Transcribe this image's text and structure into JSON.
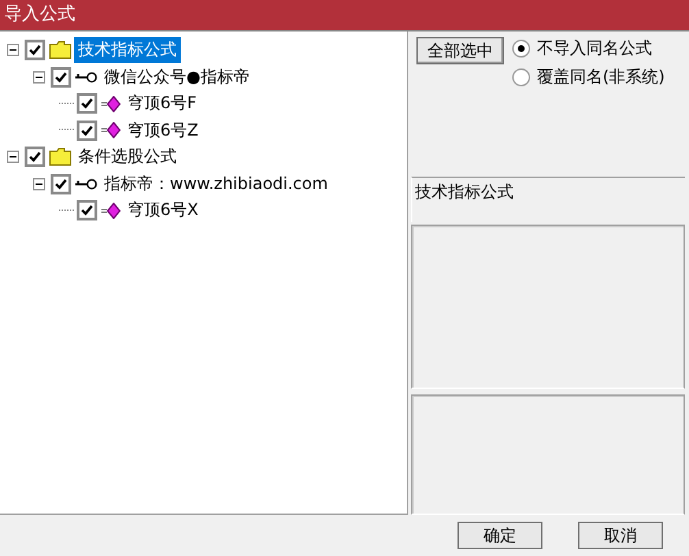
{
  "window": {
    "title": "导入公式"
  },
  "tree": [
    {
      "kind": "folder",
      "label": "技术指标公式",
      "checked": true,
      "selected": true,
      "expanded": true,
      "children": [
        {
          "kind": "group",
          "label": "微信公众号●指标帝",
          "checked": true,
          "selected": false,
          "expanded": true,
          "children": [
            {
              "kind": "formula",
              "label": "穹顶6号F",
              "checked": true,
              "selected": false
            },
            {
              "kind": "formula",
              "label": "穹顶6号Z",
              "checked": true,
              "selected": false
            }
          ]
        }
      ]
    },
    {
      "kind": "folder",
      "label": "条件选股公式",
      "checked": true,
      "selected": false,
      "expanded": true,
      "children": [
        {
          "kind": "group",
          "label": "指标帝：www.zhibiaodi.com",
          "checked": true,
          "selected": false,
          "expanded": true,
          "children": [
            {
              "kind": "formula",
              "label": "穹顶6号X",
              "checked": true,
              "selected": false
            }
          ]
        }
      ]
    }
  ],
  "select_all_button": "全部选中",
  "options": [
    {
      "label": "不导入同名公式",
      "selected": true
    },
    {
      "label": "覆盖同名(非系统)",
      "selected": false
    }
  ],
  "info_label": "技术指标公式",
  "buttons": [
    "确定",
    "取消"
  ]
}
